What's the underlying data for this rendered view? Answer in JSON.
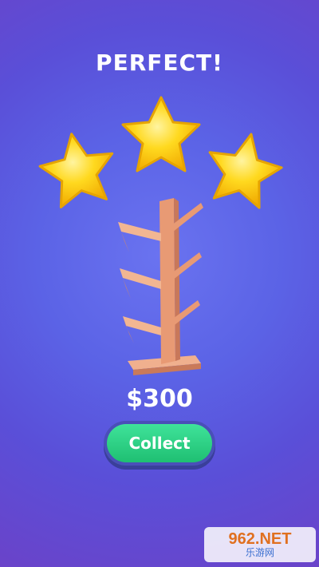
{
  "result": {
    "title": "PERFECT!",
    "stars_earned": 3,
    "stars_total": 3,
    "reward": "$300",
    "collect_label": "Collect"
  },
  "watermark": {
    "top": "962.NET",
    "bottom": "乐游网"
  },
  "colors": {
    "background": "#5b63e6",
    "star": "#f7d21e",
    "button": "#2fd483",
    "shelf": "#e8a07c"
  }
}
